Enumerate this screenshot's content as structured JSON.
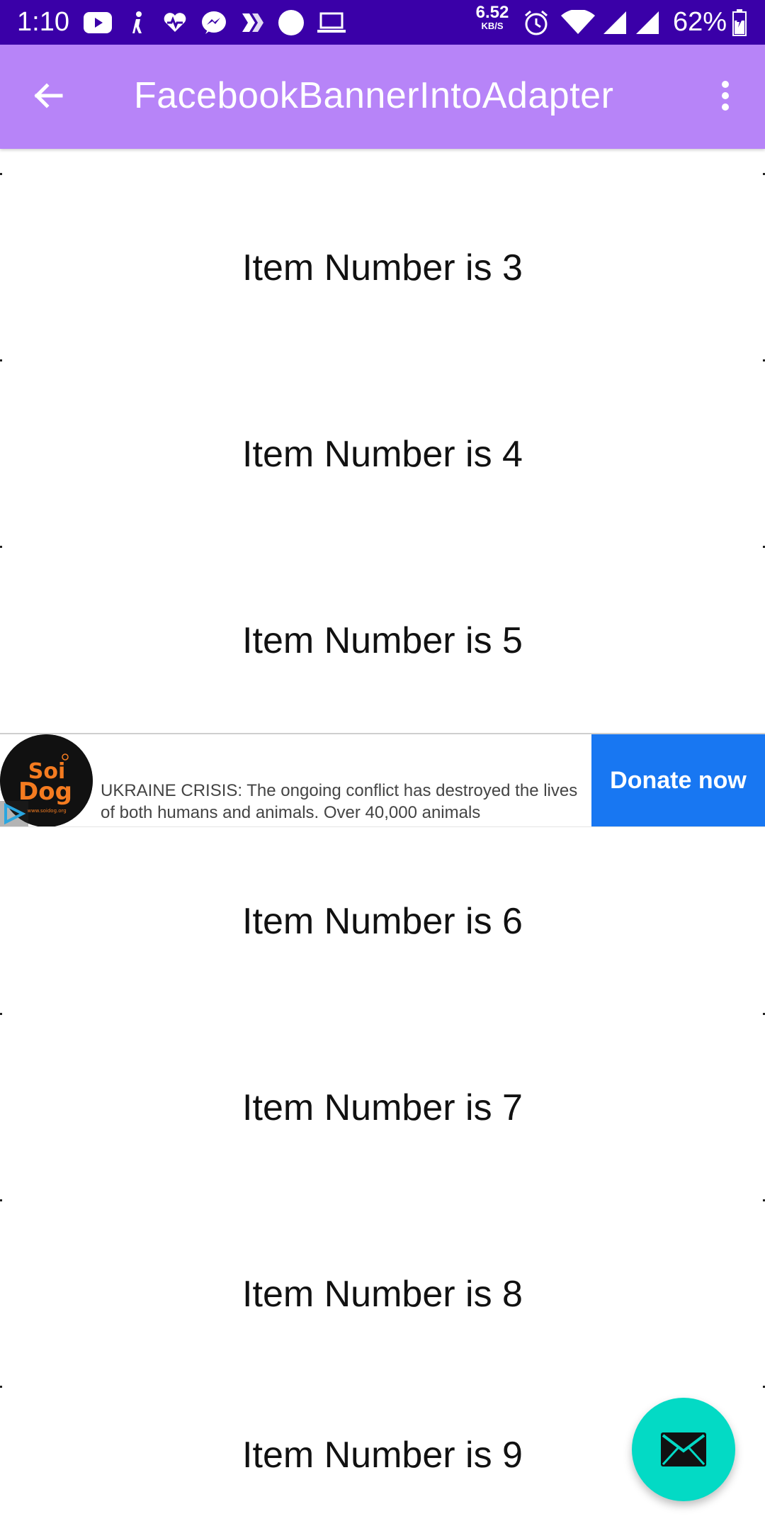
{
  "status_bar": {
    "time": "1:10",
    "net_speed_value": "6.52",
    "net_speed_unit": "KB/S",
    "battery": "62%",
    "icons": [
      "youtube-icon",
      "fit-icon",
      "health-icon",
      "messenger-icon",
      "chevron-app-icon",
      "circle-icon",
      "laptop-icon",
      "alarm-icon",
      "wifi-icon",
      "signal-icon",
      "signal-icon-2",
      "battery-icon"
    ]
  },
  "app_bar": {
    "title": "FacebookBannerIntoAdapter",
    "back_icon": "arrow-back-icon",
    "menu_icon": "more-vert-icon"
  },
  "items": [
    "Item Number is 3",
    "Item Number is 4",
    "Item Number is 5",
    "Item Number is 6",
    "Item Number is 7",
    "Item Number is 8",
    "Item Number is 9"
  ],
  "ad": {
    "text": "UKRAINE CRISIS: The ongoing conflict has destroyed the lives of both humans and animals. Over 40,000 animals",
    "cta": "Donate now",
    "logo_text": "Soi Dog",
    "logo_url_text": "www.soidog.org",
    "adchoices_icon": "adchoices-icon"
  },
  "fab": {
    "icon": "mail-icon"
  },
  "colors": {
    "status_bar": "#3a00a8",
    "app_bar": "#b784f8",
    "cta": "#1877f2",
    "fab": "#03dac5"
  }
}
